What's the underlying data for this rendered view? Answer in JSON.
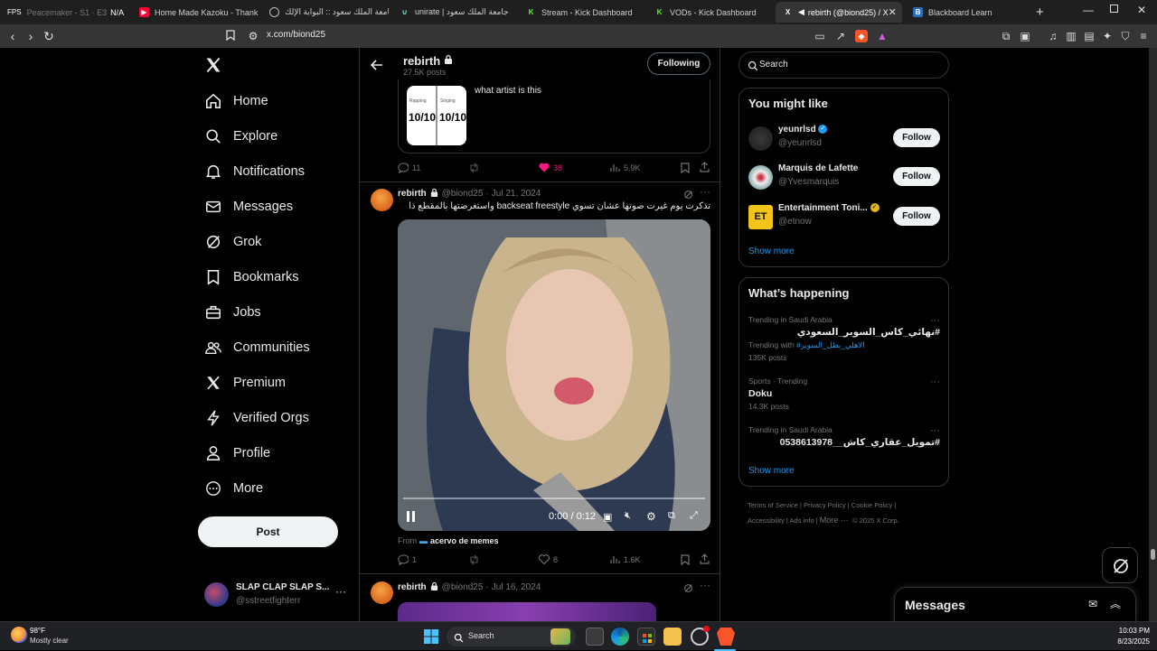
{
  "browser": {
    "tabs": [
      {
        "label": "Peacemaker - S1 · E3",
        "extra": "N/A",
        "prefix": "FPS"
      },
      {
        "label": "Home Made Kazoku - Thank Y"
      },
      {
        "label": "جامعة الملك سعود :: البوابة الإلك"
      },
      {
        "label": "unirate | جامعة الملك سعود"
      },
      {
        "label": "Stream - Kick Dashboard"
      },
      {
        "label": "VODs - Kick Dashboard"
      },
      {
        "label": "rebirth (@biond25) / X"
      },
      {
        "label": "Blackboard Learn"
      }
    ],
    "url": "x.com/biond25"
  },
  "nav": {
    "items": [
      {
        "label": "Home",
        "icon": "home-icon"
      },
      {
        "label": "Explore",
        "icon": "search-icon"
      },
      {
        "label": "Notifications",
        "icon": "bell-icon"
      },
      {
        "label": "Messages",
        "icon": "envelope-icon"
      },
      {
        "label": "Grok",
        "icon": "grok-icon"
      },
      {
        "label": "Bookmarks",
        "icon": "bookmark-icon"
      },
      {
        "label": "Jobs",
        "icon": "briefcase-icon"
      },
      {
        "label": "Communities",
        "icon": "people-icon"
      },
      {
        "label": "Premium",
        "icon": "x-logo-icon"
      },
      {
        "label": "Verified Orgs",
        "icon": "lightning-icon"
      },
      {
        "label": "Profile",
        "icon": "person-icon"
      },
      {
        "label": "More",
        "icon": "more-circle-icon"
      }
    ],
    "post_label": "Post",
    "account": {
      "name": "SLAP CLAP SLAP S...",
      "handle": "@sstreetfighterr"
    }
  },
  "profile_header": {
    "name": "rebirth",
    "posts": "27.5K posts",
    "following_label": "Following"
  },
  "quote_post": {
    "text": "what artist is this",
    "thumb_labels": [
      "Rapping",
      "Singing"
    ],
    "scores": [
      "10/10",
      "10/10"
    ]
  },
  "post1_actions": {
    "replies": "11",
    "likes": "38",
    "views": "5.9K"
  },
  "post2": {
    "name": "rebirth",
    "handle": "@biond25",
    "date": "Jul 21, 2024",
    "text": "تذكرت يوم غيرت صوتها عشان تسوي backseat freestyle واستعرضتها بالمقطع ذا",
    "video_time": "0:00 / 0:12",
    "from_label": "From",
    "from_source": "acervo de memes",
    "replies": "1",
    "likes": "8",
    "views": "1.6K"
  },
  "post3": {
    "name": "rebirth",
    "handle": "@biond25",
    "date": "Jul 16, 2024"
  },
  "search": {
    "placeholder": "Search"
  },
  "you_might_like": {
    "title": "You might like",
    "users": [
      {
        "name": "yeunrlsd",
        "handle": "@yeunrlsd",
        "follow": "Follow"
      },
      {
        "name": "Marquis de Lafette",
        "handle": "@Yvesmarquis",
        "follow": "Follow"
      },
      {
        "name": "Entertainment Toni...",
        "handle": "@etnow",
        "follow": "Follow",
        "avatar_text": "ET"
      }
    ],
    "show_more": "Show more"
  },
  "whats_happening": {
    "title": "What’s happening",
    "trends": [
      {
        "category": "Trending in Saudi Arabia",
        "title": "#نهائي_كاس_السوبر_السعودي",
        "with_label": "Trending with",
        "with_tag": "#الاهلي_بطل_السوبر",
        "count": "135K posts"
      },
      {
        "category": "Sports · Trending",
        "title": "Doku",
        "count": "14.3K posts"
      },
      {
        "category": "Trending in Saudi Arabia",
        "title": "#تمويل_عقاري_كاش__0538613978"
      }
    ],
    "show_more": "Show more"
  },
  "footer": {
    "links": [
      "Terms of Service",
      "Privacy Policy",
      "Cookie Policy",
      "Accessibility",
      "Ads info",
      "More ···",
      "© 2025 X Corp."
    ]
  },
  "messages_drawer": {
    "title": "Messages"
  },
  "taskbar": {
    "weather_temp": "98°F",
    "weather_desc": "Mostly clear",
    "search_label": "Search",
    "time": "10:03 PM",
    "date": "8/23/2025"
  },
  "colors": {
    "accent": "#1d9bf0",
    "like": "#f91880",
    "bg": "#000000"
  }
}
